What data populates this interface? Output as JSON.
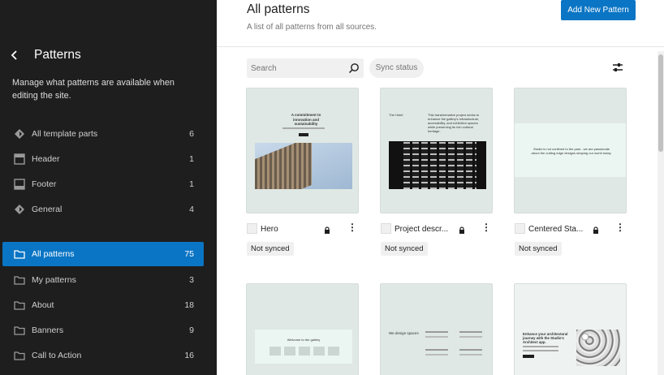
{
  "sidebar": {
    "title": "Patterns",
    "description": "Manage what patterns are available when editing the site.",
    "template_parts": [
      {
        "label": "All template parts",
        "count": "6",
        "icon": "diamond-icon"
      },
      {
        "label": "Header",
        "count": "1",
        "icon": "header-icon"
      },
      {
        "label": "Footer",
        "count": "1",
        "icon": "footer-icon"
      },
      {
        "label": "General",
        "count": "4",
        "icon": "diamond-icon"
      }
    ],
    "categories": [
      {
        "label": "All patterns",
        "count": "75",
        "active": true
      },
      {
        "label": "My patterns",
        "count": "3"
      },
      {
        "label": "About",
        "count": "18"
      },
      {
        "label": "Banners",
        "count": "9"
      },
      {
        "label": "Call to Action",
        "count": "16"
      }
    ]
  },
  "main": {
    "title": "All patterns",
    "subtitle": "A list of all patterns from all sources.",
    "add_button": "Add New Pattern",
    "search_placeholder": "Search",
    "sync_filter": "Sync status",
    "cards": [
      {
        "name": "Hero",
        "status": "Not synced",
        "preview_heading": "A commitment to innovation and sustainability"
      },
      {
        "name": "Project descr...",
        "status": "Not synced",
        "preview_left": "The Hotel",
        "preview_text": "This transformative project seeks to enhance the gallery's infrastructure, accessibility, and exhibition spaces while preserving its rich cultural heritage."
      },
      {
        "name": "Centered Sta...",
        "status": "Not synced",
        "preview_text": "Studio is not confined to the past - we are passionate about the cutting edge designs shaping our world today."
      },
      {
        "name": "",
        "status": "",
        "preview_text": "Welcome to the gallery"
      },
      {
        "name": "",
        "status": "",
        "preview_text": "We design spaces"
      },
      {
        "name": "",
        "status": "",
        "preview_heading": "Enhance your architectural journey with the Studio's Architect app."
      }
    ],
    "colors": {
      "accent": "#0a75c4",
      "sidebar": "#1e1e1e",
      "card_bg": "#dfe8e4"
    }
  }
}
